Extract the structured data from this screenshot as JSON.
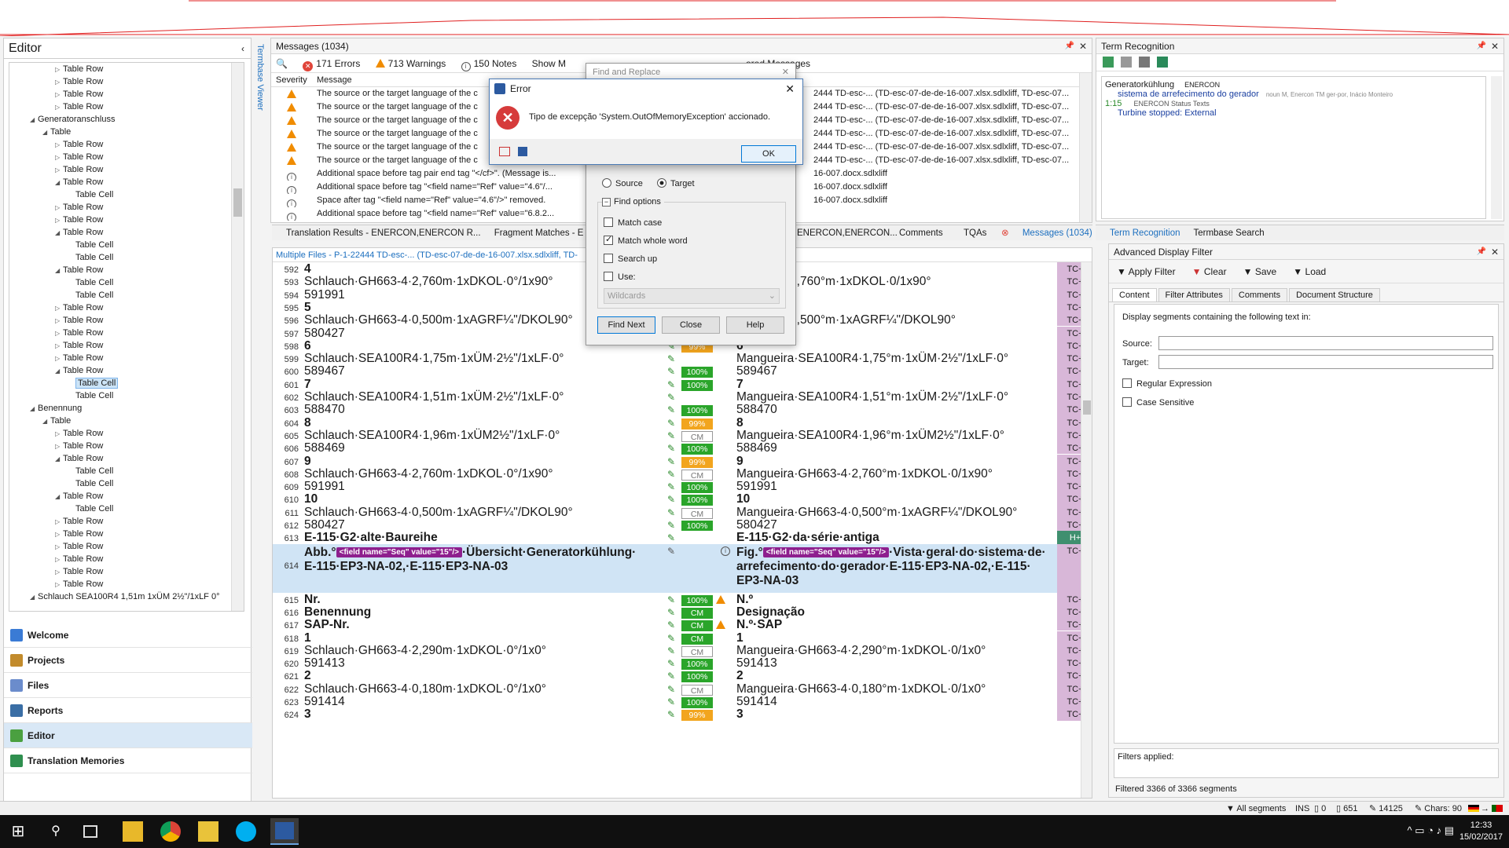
{
  "left": {
    "title": "Editor",
    "tree": [
      {
        "label": "Table Row",
        "indent": 3,
        "tw": "▷"
      },
      {
        "label": "Table Row",
        "indent": 3,
        "tw": "▷"
      },
      {
        "label": "Table Row",
        "indent": 3,
        "tw": "▷"
      },
      {
        "label": "Table Row",
        "indent": 3,
        "tw": "▷"
      },
      {
        "label": "Generatoranschluss",
        "indent": 1,
        "tw": "◢"
      },
      {
        "label": "Table",
        "indent": 2,
        "tw": "◢"
      },
      {
        "label": "Table Row",
        "indent": 3,
        "tw": "▷"
      },
      {
        "label": "Table Row",
        "indent": 3,
        "tw": "▷"
      },
      {
        "label": "Table Row",
        "indent": 3,
        "tw": "▷"
      },
      {
        "label": "Table Row",
        "indent": 3,
        "tw": "◢"
      },
      {
        "label": "Table Cell",
        "indent": 4,
        "tw": ""
      },
      {
        "label": "Table Row",
        "indent": 3,
        "tw": "▷"
      },
      {
        "label": "Table Row",
        "indent": 3,
        "tw": "▷"
      },
      {
        "label": "Table Row",
        "indent": 3,
        "tw": "◢"
      },
      {
        "label": "Table Cell",
        "indent": 4,
        "tw": ""
      },
      {
        "label": "Table Cell",
        "indent": 4,
        "tw": ""
      },
      {
        "label": "Table Row",
        "indent": 3,
        "tw": "◢"
      },
      {
        "label": "Table Cell",
        "indent": 4,
        "tw": ""
      },
      {
        "label": "Table Cell",
        "indent": 4,
        "tw": ""
      },
      {
        "label": "Table Row",
        "indent": 3,
        "tw": "▷"
      },
      {
        "label": "Table Row",
        "indent": 3,
        "tw": "▷"
      },
      {
        "label": "Table Row",
        "indent": 3,
        "tw": "▷"
      },
      {
        "label": "Table Row",
        "indent": 3,
        "tw": "▷"
      },
      {
        "label": "Table Row",
        "indent": 3,
        "tw": "▷"
      },
      {
        "label": "Table Row",
        "indent": 3,
        "tw": "◢"
      },
      {
        "label": "Table Cell",
        "indent": 4,
        "tw": "",
        "sel": true
      },
      {
        "label": "Table Cell",
        "indent": 4,
        "tw": ""
      },
      {
        "label": "Benennung",
        "indent": 1,
        "tw": "◢"
      },
      {
        "label": "Table",
        "indent": 2,
        "tw": "◢"
      },
      {
        "label": "Table Row",
        "indent": 3,
        "tw": "▷"
      },
      {
        "label": "Table Row",
        "indent": 3,
        "tw": "▷"
      },
      {
        "label": "Table Row",
        "indent": 3,
        "tw": "◢"
      },
      {
        "label": "Table Cell",
        "indent": 4,
        "tw": ""
      },
      {
        "label": "Table Cell",
        "indent": 4,
        "tw": ""
      },
      {
        "label": "Table Row",
        "indent": 3,
        "tw": "◢"
      },
      {
        "label": "Table Cell",
        "indent": 4,
        "tw": ""
      },
      {
        "label": "Table Row",
        "indent": 3,
        "tw": "▷"
      },
      {
        "label": "Table Row",
        "indent": 3,
        "tw": "▷"
      },
      {
        "label": "Table Row",
        "indent": 3,
        "tw": "▷"
      },
      {
        "label": "Table Row",
        "indent": 3,
        "tw": "▷"
      },
      {
        "label": "Table Row",
        "indent": 3,
        "tw": "▷"
      },
      {
        "label": "Table Row",
        "indent": 3,
        "tw": "▷"
      },
      {
        "label": "Schlauch SEA100R4 1,51m 1xÜM 2½\"/1xLF 0°",
        "indent": 0,
        "tw": "◢"
      }
    ],
    "nav": [
      {
        "label": "Welcome",
        "color": "#3a7bd5"
      },
      {
        "label": "Projects",
        "color": "#c28b2c"
      },
      {
        "label": "Files",
        "color": "#6b8ccc"
      },
      {
        "label": "Reports",
        "color": "#3a6ea5"
      },
      {
        "label": "Editor",
        "color": "#4aa040",
        "active": true
      },
      {
        "label": "Translation Memories",
        "color": "#2f8f4f"
      }
    ]
  },
  "messages": {
    "title": "Messages (1034)",
    "errors": "171 Errors",
    "warnings": "713 Warnings",
    "notes": "150 Notes",
    "show": "Show M",
    "ignored": "ored Messages",
    "col_severity": "Severity",
    "col_message": "Message",
    "rows": [
      {
        "sev": "warn",
        "msg": "The source or the target language of the c",
        "doc": "2444 TD-esc-... (TD-esc-07-de-de-16-007.xlsx.sdlxliff, TD-esc-07..."
      },
      {
        "sev": "warn",
        "msg": "The source or the target language of the c",
        "doc": "2444 TD-esc-... (TD-esc-07-de-de-16-007.xlsx.sdlxliff, TD-esc-07..."
      },
      {
        "sev": "warn",
        "msg": "The source or the target language of the c",
        "doc": "2444 TD-esc-... (TD-esc-07-de-de-16-007.xlsx.sdlxliff, TD-esc-07..."
      },
      {
        "sev": "warn",
        "msg": "The source or the target language of the c",
        "doc": "2444 TD-esc-... (TD-esc-07-de-de-16-007.xlsx.sdlxliff, TD-esc-07..."
      },
      {
        "sev": "warn",
        "msg": "The source or the target language of the c",
        "doc": "2444 TD-esc-... (TD-esc-07-de-de-16-007.xlsx.sdlxliff, TD-esc-07..."
      },
      {
        "sev": "warn",
        "msg": "The source or the target language of the c",
        "doc": "2444 TD-esc-... (TD-esc-07-de-de-16-007.xlsx.sdlxliff, TD-esc-07..."
      },
      {
        "sev": "info",
        "msg": "Additional space before tag pair end tag \"</cf>\". (Message is...",
        "doc": "16-007.docx.sdlxliff"
      },
      {
        "sev": "info",
        "msg": "Additional space before tag \"<field name=\"Ref\" value=\"4.6\"/...",
        "doc": "16-007.docx.sdlxliff"
      },
      {
        "sev": "info",
        "msg": "Space after tag \"<field name=\"Ref\" value=\"4.6\"/>\" removed.",
        "doc": "16-007.docx.sdlxliff"
      },
      {
        "sev": "info",
        "msg": "Additional space before tag \"<field name=\"Ref\" value=\"6.8.2...",
        "doc": ""
      }
    ]
  },
  "tabs_mid": {
    "translation_results": "Translation Results - ENERCON,ENERCON R...",
    "fragment": "Fragment Matches - E",
    "enercon": "ENERCON,ENERCON...",
    "comments": "Comments",
    "tqas": "TQAs",
    "messages": "Messages (1034)"
  },
  "grid": {
    "header": "Multiple Files - P-1-22444 TD-esc-... (TD-esc-07-de-de-16-007.xlsx.sdlxliff, TD-",
    "rows": [
      {
        "n": "592",
        "src": "4",
        "tgt": "",
        "st": "",
        "tc": "TC+",
        "bold": true
      },
      {
        "n": "593",
        "src": "Schlauch·GH663-4·2,760m·1xDKOL·0°/1x90°",
        "tgt": "GH663-4·2,760°m·1xDKOL·0/1x90°",
        "st": "",
        "tc": "TC+"
      },
      {
        "n": "594",
        "src": "591991",
        "tgt": "",
        "st": "",
        "tc": "TC+"
      },
      {
        "n": "595",
        "src": "5",
        "tgt": "",
        "st": "",
        "tc": "TC+",
        "bold": true
      },
      {
        "n": "596",
        "src": "Schlauch·GH663-4·0,500m·1xAGRF¼\"/DKOL90°",
        "tgt": "GH663-4·0,500°m·1xAGRF¼\"/DKOL90°",
        "st": "",
        "tc": "TC+"
      },
      {
        "n": "597",
        "src": "580427",
        "tgt": "",
        "st": "",
        "tc": "TC+"
      },
      {
        "n": "598",
        "src": "6",
        "tgt": "6",
        "st": "99%",
        "tc": "TC+",
        "bold": true
      },
      {
        "n": "599",
        "src": "Schlauch·SEA100R4·1,75m·1xÜM·2½\"/1xLF·0°",
        "tgt": "Mangueira·SEA100R4·1,75°m·1xÜM·2½\"/1xLF·0°",
        "st": "pen",
        "tc": "TC+"
      },
      {
        "n": "600",
        "src": "589467",
        "tgt": "589467",
        "st": "100%",
        "tc": "TC+"
      },
      {
        "n": "601",
        "src": "7",
        "tgt": "7",
        "st": "100%",
        "tc": "TC+",
        "bold": true
      },
      {
        "n": "602",
        "src": "Schlauch·SEA100R4·1,51m·1xÜM·2½\"/1xLF·0°",
        "tgt": "Mangueira·SEA100R4·1,51°m·1xÜM·2½\"/1xLF·0°",
        "st": "pen",
        "tc": "TC+"
      },
      {
        "n": "603",
        "src": "588470",
        "tgt": "588470",
        "st": "100%",
        "tc": "TC+"
      },
      {
        "n": "604",
        "src": "8",
        "tgt": "8",
        "st": "99%",
        "tc": "TC+",
        "bold": true
      },
      {
        "n": "605",
        "src": "Schlauch·SEA100R4·1,96m·1xÜM2½\"/1xLF·0°",
        "tgt": "Mangueira·SEA100R4·1,96°m·1xÜM2½\"/1xLF·0°",
        "st": "CM",
        "tc": "TC+"
      },
      {
        "n": "606",
        "src": "588469",
        "tgt": "588469",
        "st": "100%",
        "tc": "TC+"
      },
      {
        "n": "607",
        "src": "9",
        "tgt": "9",
        "st": "99%",
        "tc": "TC+",
        "bold": true
      },
      {
        "n": "608",
        "src": "Schlauch·GH663-4·2,760m·1xDKOL·0°/1x90°",
        "tgt": "Mangueira·GH663-4·2,760°m·1xDKOL·0/1x90°",
        "st": "CM",
        "tc": "TC+"
      },
      {
        "n": "609",
        "src": "591991",
        "tgt": "591991",
        "st": "100%",
        "tc": "TC+"
      },
      {
        "n": "610",
        "src": "10",
        "tgt": "10",
        "st": "100%",
        "tc": "TC+",
        "bold": true
      },
      {
        "n": "611",
        "src": "Schlauch·GH663-4·0,500m·1xAGRF¼\"/DKOL90°",
        "tgt": "Mangueira·GH663-4·0,500°m·1xAGRF¼\"/DKOL90°",
        "st": "CM",
        "tc": "TC+"
      },
      {
        "n": "612",
        "src": "580427",
        "tgt": "580427",
        "st": "100%",
        "tc": "TC+"
      },
      {
        "n": "613",
        "src": "E-115·G2·alte·Baureihe",
        "tgt": "E-115·G2·da·série·antiga",
        "st": "pen",
        "tc": "H+",
        "bold": true,
        "h": true
      }
    ],
    "row614": {
      "n": "614",
      "src_a": "Abb.°",
      "tag": "<field name=\"Seq\" value=\"15\"/>",
      "src_b": "·Übersicht·Generatorkühlung·",
      "src_c": "E-115·EP3-NA-02,·E-115·EP3-NA-03",
      "tgt_a": "Fig.°",
      "tgt_b": "·Vista·geral·do·sistema·de·",
      "tgt_c": "arrefecimento·do·gerador·E-115·EP3-NA-02,·E-115·",
      "tgt_d": "EP3-NA-03",
      "tc": "TC+"
    },
    "rows2": [
      {
        "n": "615",
        "src": "Nr.",
        "tgt": "N.º",
        "st": "100%",
        "warn": true,
        "tc": "TC+",
        "bold": true
      },
      {
        "n": "616",
        "src": "Benennung",
        "tgt": "Designação",
        "st": "CMg",
        "tc": "TC+",
        "bold": true
      },
      {
        "n": "617",
        "src": "SAP-Nr.",
        "tgt": "N.º·SAP",
        "st": "CMg",
        "warn": true,
        "tc": "TC+",
        "bold": true
      },
      {
        "n": "618",
        "src": "1",
        "tgt": "1",
        "st": "CMg",
        "tc": "TC+",
        "bold": true
      },
      {
        "n": "619",
        "src": "Schlauch·GH663-4·2,290m·1xDKOL·0°/1x0°",
        "tgt": "Mangueira·GH663-4·2,290°m·1xDKOL·0/1x0°",
        "st": "CM",
        "tc": "TC+"
      },
      {
        "n": "620",
        "src": "591413",
        "tgt": "591413",
        "st": "100%",
        "tc": "TC+"
      },
      {
        "n": "621",
        "src": "2",
        "tgt": "2",
        "st": "100%",
        "tc": "TC+",
        "bold": true
      },
      {
        "n": "622",
        "src": "Schlauch·GH663-4·0,180m·1xDKOL·0°/1x0°",
        "tgt": "Mangueira·GH663-4·0,180°m·1xDKOL·0/1x0°",
        "st": "CM",
        "tc": "TC+"
      },
      {
        "n": "623",
        "src": "591414",
        "tgt": "591414",
        "st": "100%",
        "tc": "TC+"
      },
      {
        "n": "624",
        "src": "3",
        "tgt": "3",
        "st": "99%",
        "tc": "TC+",
        "bold": true
      }
    ]
  },
  "term": {
    "title": "Term Recognition",
    "src_term": "Generatorkühlung",
    "src_tb": "ENERCON",
    "tgt_term": "sistema de arrefecimento do gerador",
    "tgt_meta": "noun M, Enercon TM ger-por, Inácio Monteiro",
    "score": "1:15",
    "status_label": "ENERCON Status Texts",
    "status_term": "Turbine stopped: External",
    "tab_term": "Term Recognition",
    "tab_tb": "Termbase Search"
  },
  "adf": {
    "title": "Advanced Display Filter",
    "apply": "Apply Filter",
    "clear": "Clear",
    "save": "Save",
    "load": "Load",
    "tabs": [
      "Content",
      "Filter Attributes",
      "Comments",
      "Document Structure"
    ],
    "desc": "Display segments containing the following text in:",
    "source": "Source:",
    "target": "Target:",
    "regex": "Regular Expression",
    "case": "Case Sensitive",
    "applied": "Filters applied:",
    "filtered": "Filtered 3366 of 3366 segments"
  },
  "find": {
    "title": "Find and Replace",
    "source": "Source",
    "target": "Target",
    "options": "Find options",
    "match_case": "Match case",
    "whole_word": "Match whole word",
    "search_up": "Search up",
    "use": "Use:",
    "use_val": "Wildcards",
    "find_next": "Find Next",
    "close": "Close",
    "help": "Help"
  },
  "error": {
    "title": "Error",
    "message": "Tipo de excepção 'System.OutOfMemoryException' accionado.",
    "ok": "OK"
  },
  "status": {
    "all_segments": "All segments",
    "ins": "INS",
    "n0": "0",
    "n651": "651",
    "n14125": "14125",
    "chars": "Chars: 90"
  },
  "taskbar": {
    "time": "12:33",
    "date": "15/02/2017"
  },
  "sidebar_vertical": "Termbase Viewer"
}
